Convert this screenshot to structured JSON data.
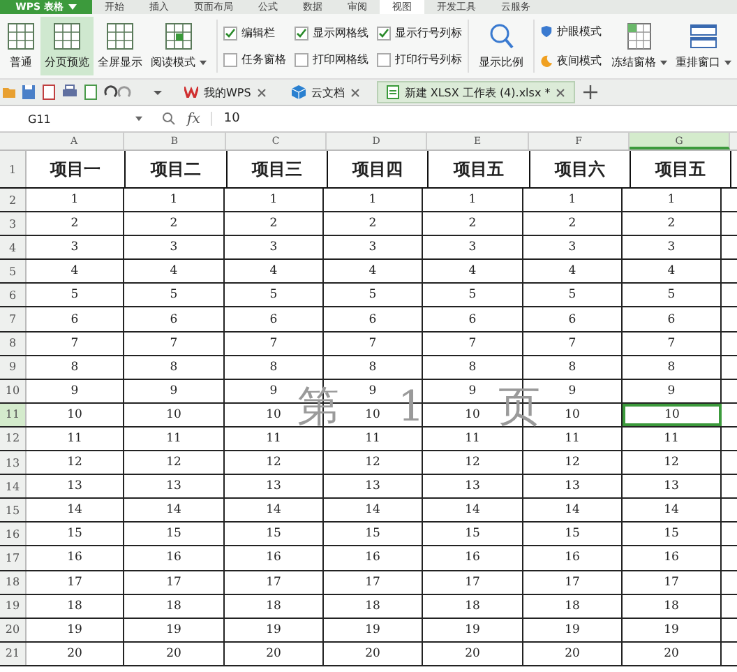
{
  "app_button": "WPS 表格",
  "menu_tabs": [
    {
      "label": "开始",
      "selected": false
    },
    {
      "label": "插入",
      "selected": false
    },
    {
      "label": "页面布局",
      "selected": false
    },
    {
      "label": "公式",
      "selected": false
    },
    {
      "label": "数据",
      "selected": false
    },
    {
      "label": "审阅",
      "selected": false
    },
    {
      "label": "视图",
      "selected": true
    },
    {
      "label": "开发工具",
      "selected": false
    },
    {
      "label": "云服务",
      "selected": false
    }
  ],
  "view_buttons": [
    {
      "label": "普通",
      "selected": false,
      "dropdown": false
    },
    {
      "label": "分页预览",
      "selected": true,
      "dropdown": false
    },
    {
      "label": "全屏显示",
      "selected": false,
      "dropdown": false
    },
    {
      "label": "阅读模式",
      "selected": false,
      "dropdown": true
    }
  ],
  "checkboxes": [
    {
      "label": "编辑栏",
      "checked": true
    },
    {
      "label": "任务窗格",
      "checked": false
    },
    {
      "label": "显示网格线",
      "checked": true
    },
    {
      "label": "打印网格线",
      "checked": false
    },
    {
      "label": "显示行号列标",
      "checked": true
    },
    {
      "label": "打印行号列标",
      "checked": false
    }
  ],
  "zoom_button": "显示比例",
  "mode_buttons": [
    {
      "label": "护眼模式",
      "kind": "eye"
    },
    {
      "label": "夜间模式",
      "kind": "night"
    }
  ],
  "window_buttons": [
    {
      "label": "冻结窗格",
      "kind": "freeze"
    },
    {
      "label": "重排窗口",
      "kind": "arrange"
    }
  ],
  "doc_tabs": [
    {
      "label": "我的WPS",
      "kind": "wps",
      "selected": false
    },
    {
      "label": "云文档",
      "kind": "cloud",
      "selected": false
    },
    {
      "label": "新建 XLSX 工作表 (4).xlsx *",
      "kind": "sheet",
      "selected": true
    }
  ],
  "formula_bar": {
    "cell_ref": "G11",
    "fx": "fx",
    "value": "10"
  },
  "page_watermark": [
    "第",
    "1",
    "页"
  ],
  "grid": {
    "columns": [
      {
        "label": "A",
        "selected": false
      },
      {
        "label": "B",
        "selected": false
      },
      {
        "label": "C",
        "selected": false
      },
      {
        "label": "D",
        "selected": false
      },
      {
        "label": "E",
        "selected": false
      },
      {
        "label": "F",
        "selected": false
      },
      {
        "label": "G",
        "selected": true
      }
    ],
    "header_row": {
      "number": "1",
      "cells": [
        "项目一",
        "项目二",
        "项目三",
        "项目四",
        "项目五",
        "项目六",
        "项目五"
      ]
    },
    "rows": [
      {
        "number": "2",
        "selected": false,
        "cells": [
          "1",
          "1",
          "1",
          "1",
          "1",
          "1",
          "1"
        ]
      },
      {
        "number": "3",
        "selected": false,
        "cells": [
          "2",
          "2",
          "2",
          "2",
          "2",
          "2",
          "2"
        ]
      },
      {
        "number": "4",
        "selected": false,
        "cells": [
          "3",
          "3",
          "3",
          "3",
          "3",
          "3",
          "3"
        ]
      },
      {
        "number": "5",
        "selected": false,
        "cells": [
          "4",
          "4",
          "4",
          "4",
          "4",
          "4",
          "4"
        ]
      },
      {
        "number": "6",
        "selected": false,
        "cells": [
          "5",
          "5",
          "5",
          "5",
          "5",
          "5",
          "5"
        ]
      },
      {
        "number": "7",
        "selected": false,
        "cells": [
          "6",
          "6",
          "6",
          "6",
          "6",
          "6",
          "6"
        ]
      },
      {
        "number": "8",
        "selected": false,
        "cells": [
          "7",
          "7",
          "7",
          "7",
          "7",
          "7",
          "7"
        ]
      },
      {
        "number": "9",
        "selected": false,
        "cells": [
          "8",
          "8",
          "8",
          "8",
          "8",
          "8",
          "8"
        ]
      },
      {
        "number": "10",
        "selected": false,
        "cells": [
          "9",
          "9",
          "9",
          "9",
          "9",
          "9",
          "9"
        ]
      },
      {
        "number": "11",
        "selected": true,
        "cells": [
          "10",
          "10",
          "10",
          "10",
          "10",
          "10",
          "10"
        ]
      },
      {
        "number": "12",
        "selected": false,
        "cells": [
          "11",
          "11",
          "11",
          "11",
          "11",
          "11",
          "11"
        ]
      },
      {
        "number": "13",
        "selected": false,
        "cells": [
          "12",
          "12",
          "12",
          "12",
          "12",
          "12",
          "12"
        ]
      },
      {
        "number": "14",
        "selected": false,
        "cells": [
          "13",
          "13",
          "13",
          "13",
          "13",
          "13",
          "13"
        ]
      },
      {
        "number": "15",
        "selected": false,
        "cells": [
          "14",
          "14",
          "14",
          "14",
          "14",
          "14",
          "14"
        ]
      },
      {
        "number": "16",
        "selected": false,
        "cells": [
          "15",
          "15",
          "15",
          "15",
          "15",
          "15",
          "15"
        ]
      },
      {
        "number": "17",
        "selected": false,
        "cells": [
          "16",
          "16",
          "16",
          "16",
          "16",
          "16",
          "16"
        ]
      },
      {
        "number": "18",
        "selected": false,
        "cells": [
          "17",
          "17",
          "17",
          "17",
          "17",
          "17",
          "17"
        ]
      },
      {
        "number": "19",
        "selected": false,
        "cells": [
          "18",
          "18",
          "18",
          "18",
          "18",
          "18",
          "18"
        ]
      },
      {
        "number": "20",
        "selected": false,
        "cells": [
          "19",
          "19",
          "19",
          "19",
          "19",
          "19",
          "19"
        ]
      },
      {
        "number": "21",
        "selected": false,
        "cells": [
          "20",
          "20",
          "20",
          "20",
          "20",
          "20",
          "20"
        ]
      }
    ]
  }
}
